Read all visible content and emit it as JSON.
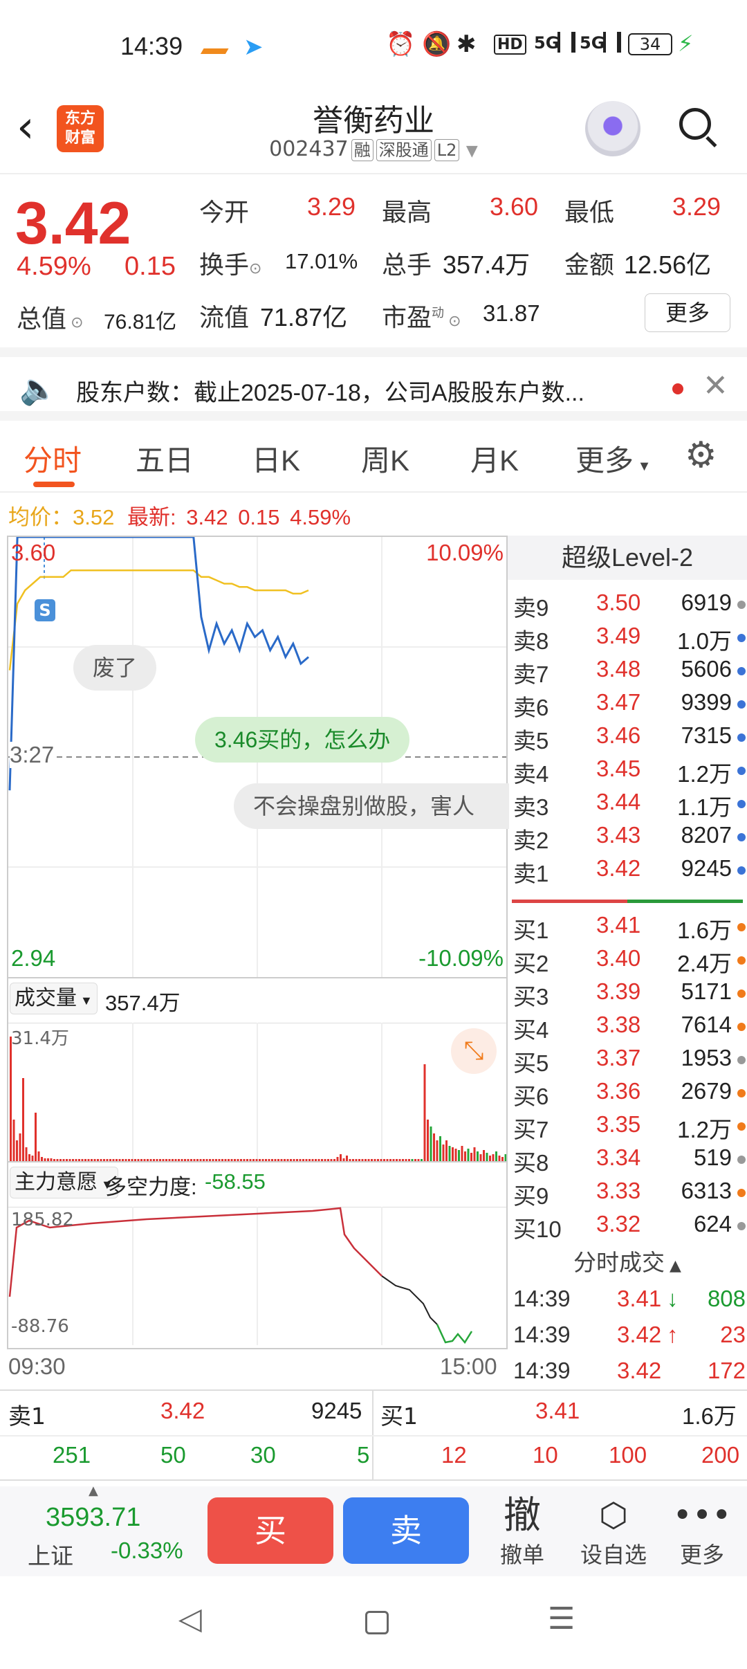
{
  "status": {
    "time": "14:39",
    "net_label": "HD",
    "signal1": "5G",
    "signal2": "5G",
    "battery": "34"
  },
  "header": {
    "title": "誉衡药业",
    "logo_line1": "东方",
    "logo_line2": "财富",
    "code": "002437",
    "tag_rong": "融",
    "tag_sgt": "深股通",
    "tag_l2": "L2"
  },
  "quote": {
    "price": "3.42",
    "change_pct": "4.59%",
    "change": "0.15",
    "open_label": "今开",
    "open": "3.29",
    "high_label": "最高",
    "high": "3.60",
    "low_label": "最低",
    "low": "3.29",
    "turnover_label": "换手",
    "turnover": "17.01%",
    "volume_label": "总手",
    "volume": "357.4万",
    "amount_label": "金额",
    "amount": "12.56亿",
    "mcap_label": "总值",
    "mcap": "76.81亿",
    "float_label": "流值",
    "float": "71.87亿",
    "pe_label": "市盈",
    "pe_sup": "动",
    "pe": "31.87",
    "more_btn": "更多"
  },
  "notice": {
    "text": "股东户数：截止2025-07-18，公司A股股东户数..."
  },
  "tabs": [
    "分时",
    "五日",
    "日K",
    "周K",
    "月K",
    "更多"
  ],
  "avg": {
    "label": "均价：",
    "value": "3.52",
    "latest_label": "最新:",
    "latest": "3.42",
    "chg": "0.15",
    "pct": "4.59%"
  },
  "chart": {
    "top_price": "3.60",
    "top_pct": "10.09%",
    "mid_price": "3:27",
    "bottom_price": "2.94",
    "bottom_pct": "-10.09%",
    "s_marker": "S",
    "comment1": "废了",
    "comment2": "3.46买的，怎么办",
    "comment3": "不会操盘别做股，害人",
    "price_series": [
      3.22,
      3.6,
      3.6,
      3.6,
      3.6,
      3.6,
      3.6,
      3.6,
      3.6,
      3.6,
      3.6,
      3.6,
      3.6,
      3.6,
      3.6,
      3.6,
      3.6,
      3.6,
      3.6,
      3.6,
      3.6,
      3.6,
      3.6,
      3.6,
      3.6,
      3.48,
      3.43,
      3.47,
      3.44,
      3.46,
      3.43,
      3.47,
      3.45,
      3.46,
      3.43,
      3.45,
      3.42,
      3.44,
      3.41,
      3.42
    ],
    "avg_series": [
      3.4,
      3.5,
      3.52,
      3.53,
      3.54,
      3.54,
      3.54,
      3.54,
      3.55,
      3.55,
      3.55,
      3.55,
      3.55,
      3.55,
      3.55,
      3.55,
      3.55,
      3.55,
      3.55,
      3.55,
      3.55,
      3.55,
      3.55,
      3.55,
      3.55,
      3.54,
      3.54,
      3.535,
      3.53,
      3.53,
      3.525,
      3.525,
      3.52,
      3.52,
      3.52,
      3.52,
      3.52,
      3.515,
      3.515,
      3.52
    ]
  },
  "volume": {
    "label": "成交量",
    "total": "357.4万",
    "max_label": "31.4万"
  },
  "indicator": {
    "label": "主力意愿",
    "name": "多空力度:",
    "value": "-58.55",
    "top": "185.82",
    "bottom": "-88.76",
    "time_start": "09:30",
    "time_end": "15:00"
  },
  "level2": {
    "title": "超级Level-2",
    "asks": [
      {
        "l": "卖9",
        "p": "3.50",
        "v": "6919",
        "c": "#999"
      },
      {
        "l": "卖8",
        "p": "3.49",
        "v": "1.0万",
        "c": "#3b73d6"
      },
      {
        "l": "卖7",
        "p": "3.48",
        "v": "5606",
        "c": "#3b73d6"
      },
      {
        "l": "卖6",
        "p": "3.47",
        "v": "9399",
        "c": "#3b73d6"
      },
      {
        "l": "卖5",
        "p": "3.46",
        "v": "7315",
        "c": "#3b73d6"
      },
      {
        "l": "卖4",
        "p": "3.45",
        "v": "1.2万",
        "c": "#3b73d6"
      },
      {
        "l": "卖3",
        "p": "3.44",
        "v": "1.1万",
        "c": "#3b73d6"
      },
      {
        "l": "卖2",
        "p": "3.43",
        "v": "8207",
        "c": "#3b73d6"
      },
      {
        "l": "卖1",
        "p": "3.42",
        "v": "9245",
        "c": "#3b73d6"
      }
    ],
    "bids": [
      {
        "l": "买1",
        "p": "3.41",
        "v": "1.6万",
        "c": "#f07a1a"
      },
      {
        "l": "买2",
        "p": "3.40",
        "v": "2.4万",
        "c": "#f07a1a"
      },
      {
        "l": "买3",
        "p": "3.39",
        "v": "5171",
        "c": "#f07a1a"
      },
      {
        "l": "买4",
        "p": "3.38",
        "v": "7614",
        "c": "#f07a1a"
      },
      {
        "l": "买5",
        "p": "3.37",
        "v": "1953",
        "c": "#999"
      },
      {
        "l": "买6",
        "p": "3.36",
        "v": "2679",
        "c": "#f07a1a"
      },
      {
        "l": "买7",
        "p": "3.35",
        "v": "1.2万",
        "c": "#f07a1a"
      },
      {
        "l": "买8",
        "p": "3.34",
        "v": "519",
        "c": "#999"
      },
      {
        "l": "买9",
        "p": "3.33",
        "v": "6313",
        "c": "#f07a1a"
      },
      {
        "l": "买10",
        "p": "3.32",
        "v": "624",
        "c": "#999"
      }
    ],
    "tick_title": "分时成交",
    "ticks": [
      {
        "t": "14:39",
        "p": "3.41",
        "arrow": "↓",
        "v": "808"
      },
      {
        "t": "14:39",
        "p": "3.42",
        "arrow": "↑",
        "v": "23"
      },
      {
        "t": "14:39",
        "p": "3.42",
        "arrow": "",
        "v": "172"
      }
    ]
  },
  "trades": {
    "left_label": "卖1",
    "left_price": "3.42",
    "left_vol": "9245",
    "right_label": "买1",
    "right_price": "3.41",
    "right_vol": "1.6万",
    "left_nums": [
      "251",
      "50",
      "30",
      "5"
    ],
    "right_nums": [
      "12",
      "10",
      "100",
      "200"
    ]
  },
  "bottom": {
    "index_value": "3593.71",
    "index_name": "上证",
    "index_pct": "-0.33%",
    "buy": "买",
    "sell": "卖",
    "cancel_icon": "撤",
    "cancel": "撤单",
    "watch": "设自选",
    "more": "更多"
  }
}
